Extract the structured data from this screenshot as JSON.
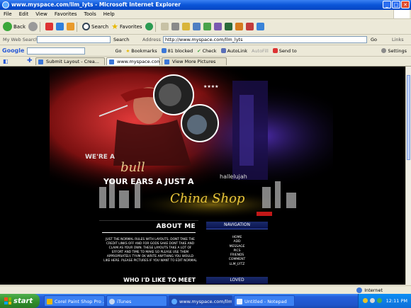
{
  "window": {
    "title": "www.myspace.com/llm_lyts - Microsoft Internet Explorer",
    "controls": [
      "_",
      "□",
      "✕"
    ]
  },
  "menu": [
    "File",
    "Edit",
    "View",
    "Favorites",
    "Tools",
    "Help"
  ],
  "toolbar": {
    "back": "Back",
    "search": "Search",
    "favorites": "Favorites",
    "go": "Go",
    "links": "Links"
  },
  "address": {
    "websearch_label": "My Web Search",
    "search_button": "Search",
    "address_label": "Address",
    "url": "http://www.myspace.com/llm_lyts"
  },
  "google_bar": {
    "logo": "Google",
    "go": "Go",
    "bookmarks": "Bookmarks",
    "blocked": "81 blocked",
    "check": "Check",
    "autolink": "AutoLink",
    "autofill": "AutoFill",
    "send_to": "Send to",
    "settings": "Settings"
  },
  "tabs": [
    {
      "label": "Submit Layout - Crea..."
    },
    {
      "label": "www.myspace.com/llm_..."
    },
    {
      "label": "View More Pictures"
    }
  ],
  "page": {
    "banner": {
      "line1": "WE'RE A",
      "word_bull": "bull",
      "line2": "YOUR EARS A JUST A",
      "word_shop": "China Shop",
      "hallelujah": "hallelujah",
      "stars": "★★★★"
    },
    "about": {
      "header": "ABOUT ME",
      "body": "Just the normal rules with layouts. Dont take the credit links off and for gods sake dont take and claim as your own. These layouts take a lot of effort and time to make so please use them appropriately. Tyvm ok write anything you would like here. Please pictures if you want to edit normal",
      "who": "WHO I'D LIKE TO MEET"
    },
    "nav": {
      "header": "NAVIGATION",
      "items": [
        "Home",
        "Add",
        "Message",
        "Pics",
        "Friends",
        "Comment",
        "LLM_Lytz"
      ],
      "loved": "LOVED"
    }
  },
  "status": {
    "zone": "Internet"
  },
  "taskbar": {
    "start": "start",
    "tasks": [
      {
        "label": "Corel Paint Shop Pro ..."
      },
      {
        "label": "iTunes"
      },
      {
        "label": "www.myspace.com/llm_..."
      },
      {
        "label": "Untitled - Notepad"
      }
    ],
    "clock": "12:11 PM"
  }
}
